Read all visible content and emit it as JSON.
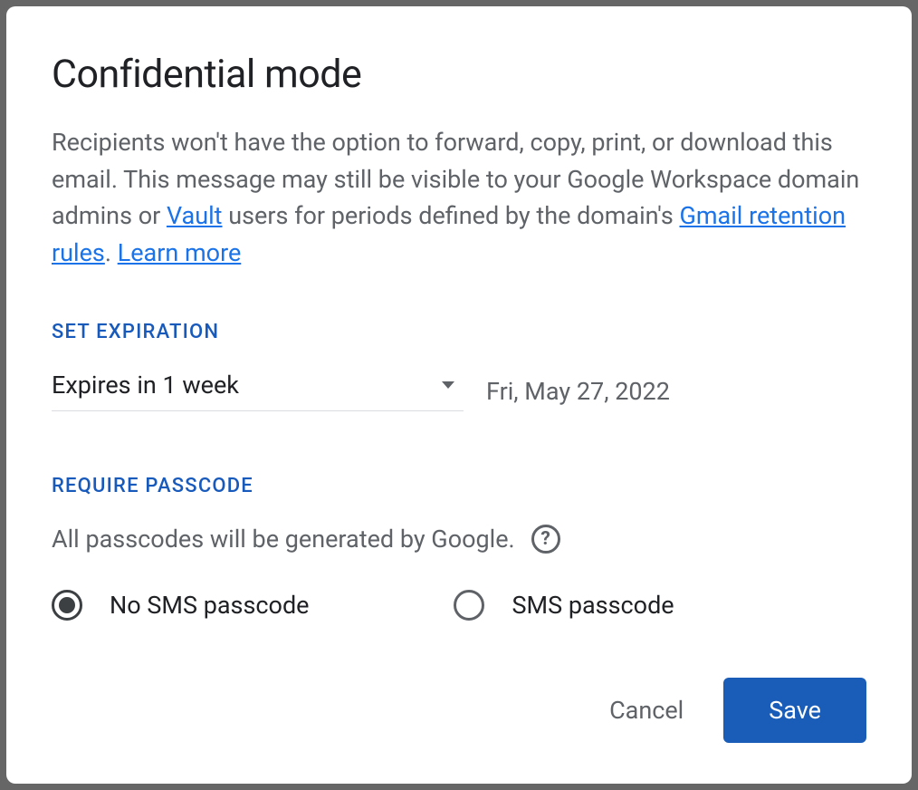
{
  "dialog": {
    "title": "Confidential mode",
    "description_part1": "Recipients won't have the option to forward, copy, print, or download this email. This message may still be visible to your Google Workspace domain admins or ",
    "link_vault": "Vault",
    "description_part2": " users for periods defined by the domain's ",
    "link_retention": "Gmail retention rules",
    "description_part3": ". ",
    "link_learn": "Learn more"
  },
  "expiration": {
    "section_label": "SET EXPIRATION",
    "selected": "Expires in 1 week",
    "date": "Fri, May 27, 2022"
  },
  "passcode": {
    "section_label": "REQUIRE PASSCODE",
    "subtext": "All passcodes will be generated by Google.",
    "help_symbol": "?",
    "option_no_sms": "No SMS passcode",
    "option_sms": "SMS passcode",
    "selected": "no_sms"
  },
  "buttons": {
    "cancel": "Cancel",
    "save": "Save"
  }
}
